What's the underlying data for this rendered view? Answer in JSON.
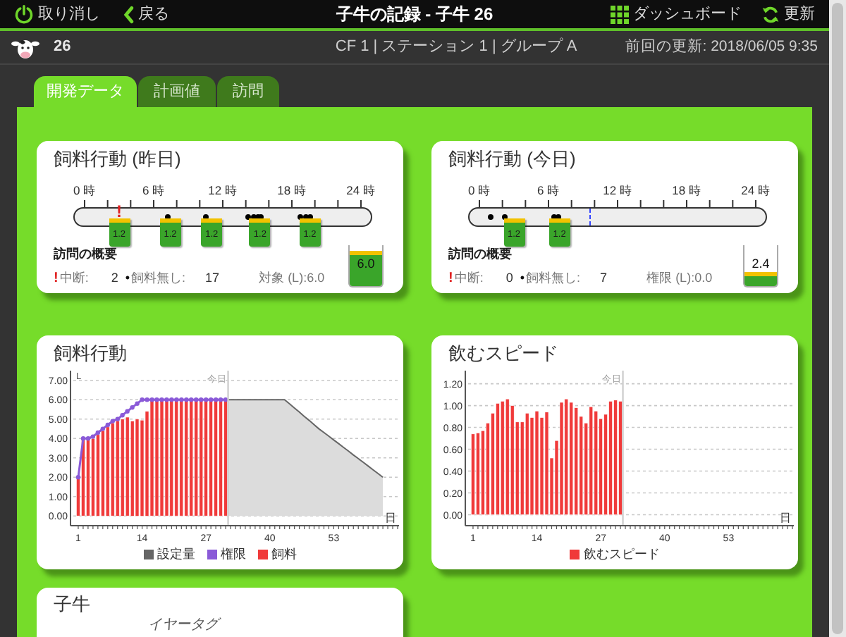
{
  "header": {
    "buttons_left": [
      {
        "kind": "power",
        "label": "取り消し"
      },
      {
        "kind": "back",
        "label": "戻る"
      }
    ],
    "title": "子牛の記録 - 子牛 26",
    "buttons_right": [
      {
        "kind": "grid",
        "label": "ダッシュボード"
      },
      {
        "kind": "refresh",
        "label": "更新"
      }
    ]
  },
  "info_bar": {
    "calf_number": "26",
    "location": "CF 1 | ステーション 1 | グループ A",
    "last_update": "前回の更新: 2018/06/05 9:35"
  },
  "tabs": [
    {
      "label": "開発データ",
      "selected": true
    },
    {
      "label": "計画値",
      "selected": false
    },
    {
      "label": "訪問",
      "selected": false
    }
  ],
  "feeding_yesterday": {
    "title": "飼料行動 (昨日)",
    "hour_labels": [
      "0 時",
      "6 時",
      "12 時",
      "18 時",
      "24 時"
    ],
    "events": [
      {
        "kind": "interrupt",
        "level": 0.125,
        "label": "!"
      },
      {
        "kind": "no_feed",
        "level": 0.3
      },
      {
        "kind": "no_feed",
        "level": 0.44
      },
      {
        "kind": "no_feed",
        "level": 0.59
      },
      {
        "kind": "no_feed",
        "level": 0.61
      },
      {
        "kind": "no_feed",
        "level": 0.625
      },
      {
        "kind": "no_feed",
        "level": 0.64
      },
      {
        "kind": "no_feed",
        "level": 0.78
      },
      {
        "kind": "no_feed",
        "level": 0.8
      },
      {
        "kind": "no_feed",
        "level": 0.815
      },
      {
        "kind": "feed",
        "level": 0.125,
        "amount": "1.2"
      },
      {
        "kind": "feed",
        "level": 0.31,
        "amount": "1.2"
      },
      {
        "kind": "feed",
        "level": 0.46,
        "amount": "1.2"
      },
      {
        "kind": "feed",
        "level": 0.635,
        "amount": "1.2"
      },
      {
        "kind": "feed",
        "level": 0.815,
        "amount": "1.2"
      }
    ],
    "summary": {
      "title": "訪問の概要",
      "interrupt": {
        "mark": "!",
        "label": "中断:",
        "value": "2"
      },
      "no_feed": {
        "mark": "•",
        "label": "飼料無し:",
        "value": "17"
      },
      "target": "対象 (L):6.0",
      "jug": {
        "reading": "6.0",
        "level": 0.85
      }
    }
  },
  "feeding_today": {
    "title": "飼料行動 (今日)",
    "hour_labels": [
      "0 時",
      "6 時",
      "12 時",
      "18 時",
      "24 時"
    ],
    "now": {
      "level": 0.4
    },
    "events": [
      {
        "kind": "no_feed",
        "level": 0.04
      },
      {
        "kind": "no_feed",
        "level": 0.09
      },
      {
        "kind": "no_feed",
        "level": 0.27
      },
      {
        "kind": "no_feed",
        "level": 0.285
      },
      {
        "kind": "feed",
        "level": 0.125,
        "amount": "1.2"
      },
      {
        "kind": "feed",
        "level": 0.29,
        "amount": "1.2"
      }
    ],
    "summary": {
      "title": "訪問の概要",
      "interrupt": {
        "mark": "!",
        "label": "中断:",
        "value": "0"
      },
      "no_feed": {
        "mark": "•",
        "label": "飼料無し:",
        "value": "7"
      },
      "target": "権限 (L):0.0",
      "jug": {
        "reading": "2.4",
        "level": 0.35
      }
    }
  },
  "feeding_chart": {
    "chart_data": {
      "type": "bar",
      "title": "飼料行動",
      "xlabel": "日",
      "ylabel": "L",
      "x": [
        1,
        2,
        3,
        4,
        5,
        6,
        7,
        8,
        9,
        10,
        11,
        12,
        13,
        14,
        15,
        16,
        17,
        18,
        19,
        20,
        21,
        22,
        23,
        24,
        25,
        26,
        27,
        28,
        29,
        30,
        31,
        32,
        33,
        34,
        35,
        36,
        37,
        38,
        39,
        40,
        41,
        42,
        43,
        44,
        45,
        46,
        47,
        48,
        49,
        50,
        51,
        52,
        53,
        54,
        55,
        56,
        57,
        58,
        59,
        60,
        61,
        62,
        63
      ],
      "xlim": [
        0,
        66
      ],
      "ylim": [
        -0.5,
        7.5
      ],
      "xticks": [
        1,
        14,
        27,
        40,
        53
      ],
      "grid": true,
      "yticks": [
        {
          "value": 0,
          "label": "0.00"
        },
        {
          "value": 1,
          "label": "1.00"
        },
        {
          "value": 2,
          "label": "2.00"
        },
        {
          "value": 3,
          "label": "3.00"
        },
        {
          "value": 4,
          "label": "4.00"
        },
        {
          "value": 5,
          "label": "5.00"
        },
        {
          "value": 6,
          "label": "6.00"
        },
        {
          "value": 7,
          "label": "7.00"
        }
      ],
      "ref_lines": [
        {
          "axis": "x",
          "value": 31.5,
          "label": "今日"
        }
      ],
      "series": [
        {
          "name": "設定量",
          "type": "area",
          "color": "#666666",
          "values": [
            null,
            null,
            null,
            null,
            null,
            null,
            null,
            null,
            null,
            null,
            null,
            null,
            null,
            null,
            null,
            null,
            null,
            null,
            null,
            null,
            null,
            null,
            null,
            null,
            null,
            null,
            null,
            null,
            null,
            null,
            6.0,
            6.0,
            6.0,
            6.0,
            6.0,
            6.0,
            6.0,
            6.0,
            6.0,
            6.0,
            6.0,
            6.0,
            6.0,
            5.79,
            5.57,
            5.36,
            5.14,
            4.93,
            4.71,
            4.5,
            4.31,
            4.12,
            3.92,
            3.73,
            3.54,
            3.35,
            3.15,
            2.96,
            2.77,
            2.58,
            2.38,
            2.19,
            2.0
          ]
        },
        {
          "name": "権限",
          "type": "line",
          "marker": "circle",
          "color": "#8a5ad8",
          "values": [
            2.0,
            4.0,
            4.0,
            4.1,
            4.3,
            4.5,
            4.7,
            4.9,
            5.0,
            5.2,
            5.4,
            5.6,
            5.8,
            6.0,
            6.0,
            6.0,
            6.0,
            6.0,
            6.0,
            6.0,
            6.0,
            6.0,
            6.0,
            6.0,
            6.0,
            6.0,
            6.0,
            6.0,
            6.0,
            6.0,
            6.0,
            null,
            null,
            null,
            null,
            null,
            null,
            null,
            null,
            null,
            null,
            null,
            null,
            null,
            null,
            null,
            null,
            null,
            null,
            null,
            null,
            null,
            null,
            null,
            null,
            null,
            null,
            null,
            null,
            null,
            null,
            null,
            null
          ]
        },
        {
          "name": "飼料",
          "color": "#f03a3a",
          "values": [
            2.0,
            4.0,
            4.0,
            4.0,
            4.2,
            4.4,
            4.6,
            4.8,
            4.9,
            5.0,
            5.1,
            4.9,
            5.0,
            4.95,
            5.4,
            6.0,
            6.0,
            6.0,
            6.0,
            6.0,
            6.0,
            6.0,
            6.0,
            6.0,
            6.0,
            6.0,
            6.0,
            6.0,
            6.0,
            6.0,
            6.0,
            null,
            null,
            null,
            null,
            null,
            null,
            null,
            null,
            null,
            null,
            null,
            null,
            null,
            null,
            null,
            null,
            null,
            null,
            null,
            null,
            null,
            null,
            null,
            null,
            null,
            null,
            null,
            null,
            null,
            null,
            null,
            null
          ]
        }
      ]
    }
  },
  "drink_speed_chart": {
    "chart_data": {
      "type": "bar",
      "title": "飲むスピード",
      "xlabel": "日",
      "x": [
        1,
        2,
        3,
        4,
        5,
        6,
        7,
        8,
        9,
        10,
        11,
        12,
        13,
        14,
        15,
        16,
        17,
        18,
        19,
        20,
        21,
        22,
        23,
        24,
        25,
        26,
        27,
        28,
        29,
        30,
        31
      ],
      "xlim": [
        0,
        66
      ],
      "ylim": [
        -0.1,
        1.32
      ],
      "xticks": [
        1,
        14,
        27,
        40,
        53
      ],
      "grid": true,
      "yticks": [
        {
          "value": 0,
          "label": "0.00"
        },
        {
          "value": 0.2,
          "label": "0.20"
        },
        {
          "value": 0.4,
          "label": "0.40"
        },
        {
          "value": 0.6,
          "label": "0.60"
        },
        {
          "value": 0.8,
          "label": "0.80"
        },
        {
          "value": 1.0,
          "label": "1.00"
        },
        {
          "value": 1.2,
          "label": "1.20"
        }
      ],
      "ref_lines": [
        {
          "axis": "x",
          "value": 31.5,
          "label": "今日"
        }
      ],
      "series": [
        {
          "name": "飲むスピード",
          "color": "#f03a3a",
          "values": [
            0.74,
            0.75,
            0.77,
            0.84,
            0.93,
            1.02,
            1.04,
            1.06,
            1.0,
            0.85,
            0.85,
            0.93,
            0.89,
            0.95,
            0.89,
            0.94,
            0.52,
            0.68,
            1.03,
            1.06,
            1.03,
            0.98,
            0.9,
            0.84,
            0.99,
            0.95,
            0.88,
            0.92,
            1.04,
            1.05,
            1.04
          ]
        }
      ]
    }
  },
  "calf_card": {
    "title": "子牛",
    "fields": [
      {
        "label": "イヤータグ"
      }
    ]
  }
}
